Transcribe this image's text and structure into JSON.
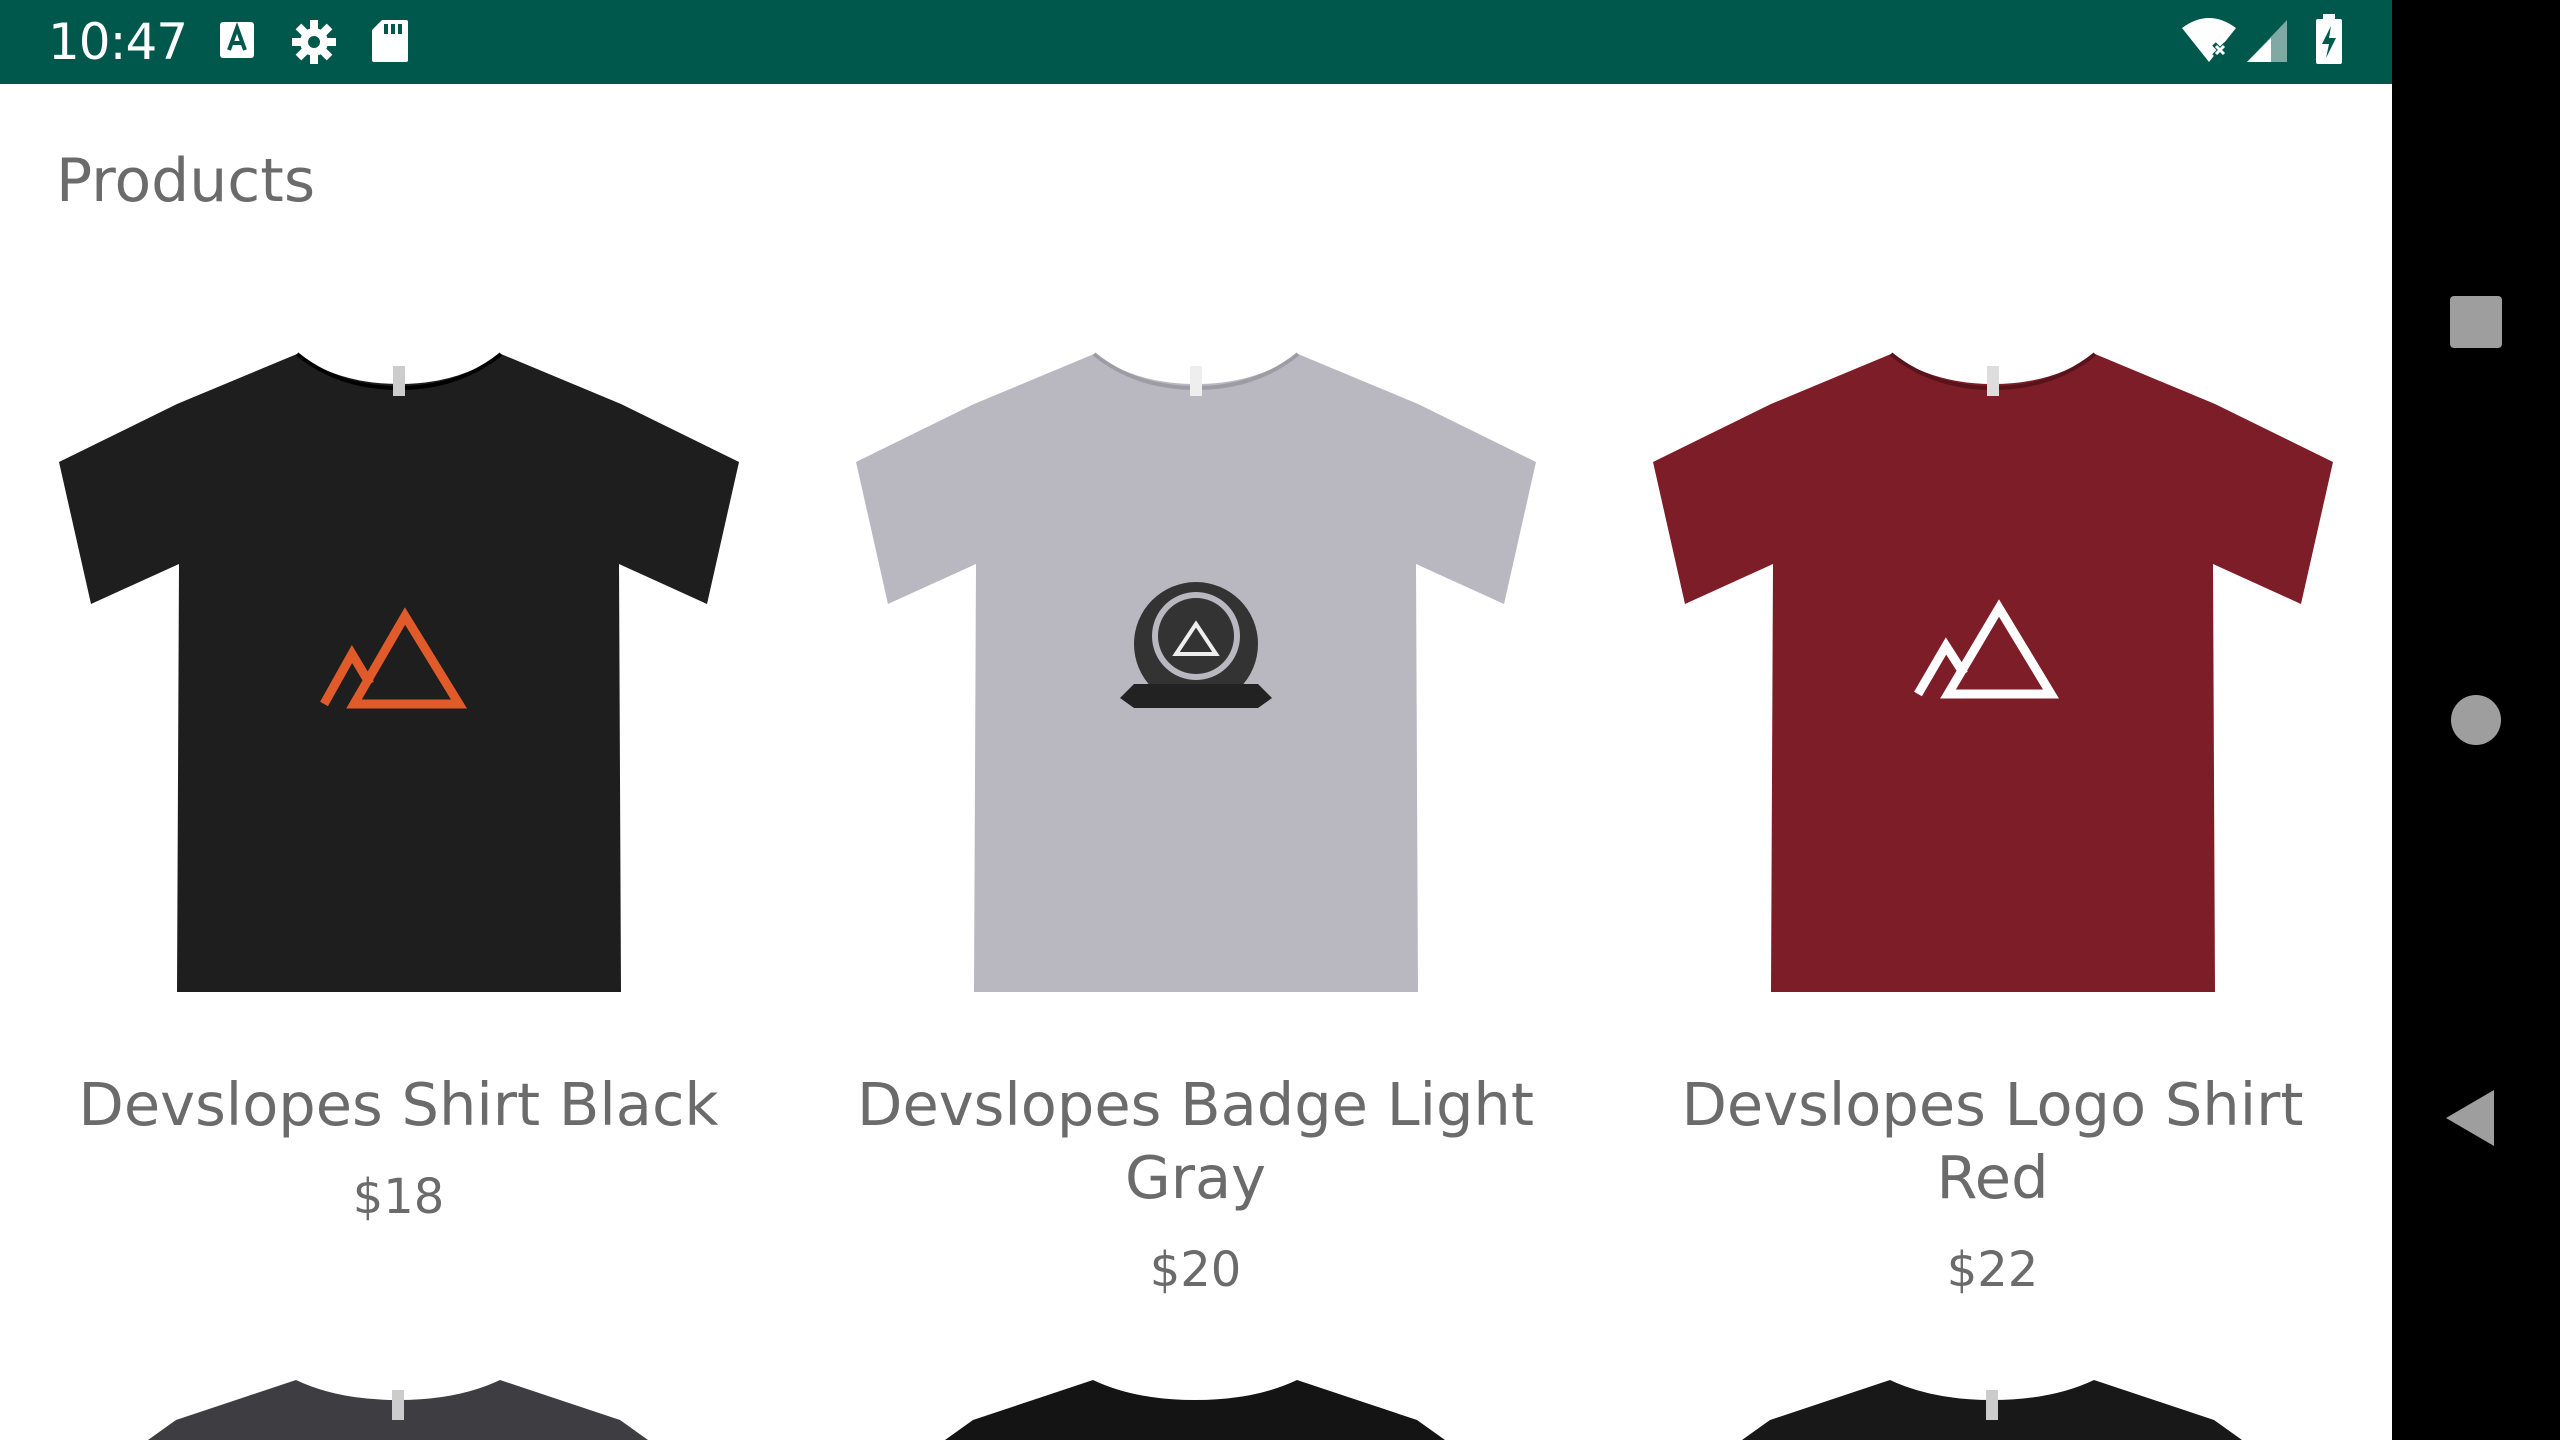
{
  "status_bar": {
    "time": "10:47",
    "background": "#00574B",
    "left_icons": [
      "font-download-icon",
      "gear-icon",
      "sd-card-icon"
    ],
    "right_icons": [
      "wifi-off-icon",
      "cell-signal-icon",
      "battery-charging-icon"
    ]
  },
  "page": {
    "title": "Products"
  },
  "products": [
    {
      "name": "Devslopes Shirt Black",
      "price": "$18",
      "shirt_color": "#1e1e1e",
      "graphic": "orange-mountain-logo"
    },
    {
      "name": "Devslopes Badge Light Gray",
      "price": "$20",
      "shirt_color": "#b9b8c1",
      "graphic": "devslopes-badge"
    },
    {
      "name": "Devslopes Logo Shirt Red",
      "price": "$22",
      "shirt_color": "#7d1d27",
      "graphic": "white-mountain-logo"
    }
  ],
  "next_row_shirt_colors": [
    "#3e3e42",
    "#141414",
    "#181818"
  ],
  "nav_bar": {
    "buttons": [
      "recents-button",
      "home-button",
      "back-button"
    ]
  }
}
